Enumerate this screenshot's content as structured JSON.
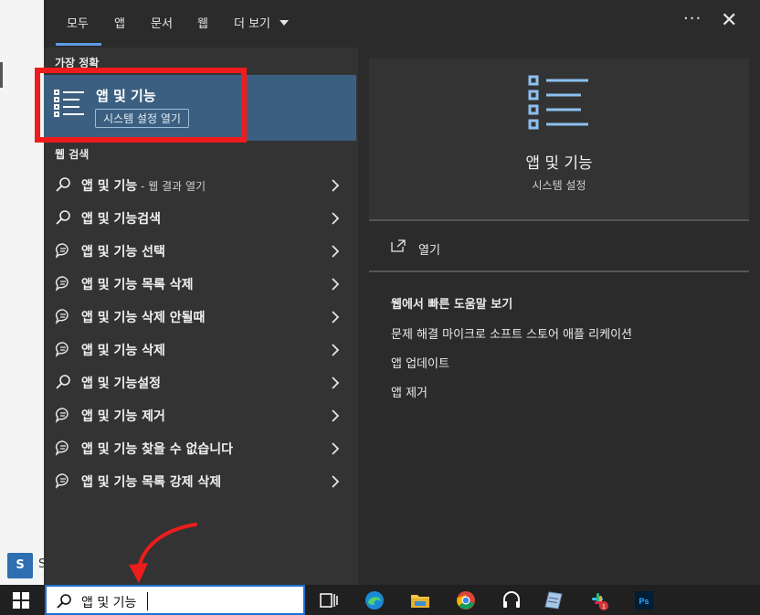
{
  "tabs": {
    "all": "모두",
    "apps": "앱",
    "documents": "문서",
    "web": "웹",
    "more": "더 보기",
    "options": "···",
    "close": "✕"
  },
  "left": {
    "best_match_header": "가장 정확",
    "best_match": {
      "title": "앱 및 기능",
      "subtitle": "시스템 설정 열기"
    },
    "web_header": "웹 검색",
    "items": [
      {
        "label": "앱 및 기능",
        "suffix": " - 웹 결과 열기",
        "icon": "search-icon"
      },
      {
        "label": "앱 및 기능검색",
        "suffix": "",
        "icon": "search-icon"
      },
      {
        "label": "앱 및 기능 선택",
        "suffix": "",
        "icon": "chat-icon"
      },
      {
        "label": "앱 및 기능 목록 삭제",
        "suffix": "",
        "icon": "chat-icon"
      },
      {
        "label": "앱 및 기능 삭제 안될때",
        "suffix": "",
        "icon": "chat-icon"
      },
      {
        "label": "앱 및 기능 삭제",
        "suffix": "",
        "icon": "chat-icon"
      },
      {
        "label": "앱 및 기능설정",
        "suffix": "",
        "icon": "search-icon"
      },
      {
        "label": "앱 및 기능 제거",
        "suffix": "",
        "icon": "chat-icon"
      },
      {
        "label": "앱 및 기능 찾을 수 없습니다",
        "suffix": "",
        "icon": "chat-icon"
      },
      {
        "label": "앱 및 기능 목록 강제 삭제",
        "suffix": "",
        "icon": "chat-icon"
      }
    ]
  },
  "right": {
    "title": "앱 및 기능",
    "subtitle": "시스템 설정",
    "open_label": "열기",
    "help_header": "웹에서 빠른 도움말 보기",
    "help_links": [
      "문제 해결 마이크로 소프트 스토어 애플 리케이션",
      "앱 업데이트",
      "앱 제거"
    ]
  },
  "background": {
    "tile_letter": "S",
    "tile_label": "S"
  },
  "taskbar": {
    "search_value": "앱 및 기능",
    "slack_badge": "1",
    "ps_label": "Ps"
  },
  "colors": {
    "panel": "#2b2b2b",
    "highlight_row": "#3b5f80",
    "accent": "#5c9be3",
    "annotation_red": "#ee1c1c"
  }
}
